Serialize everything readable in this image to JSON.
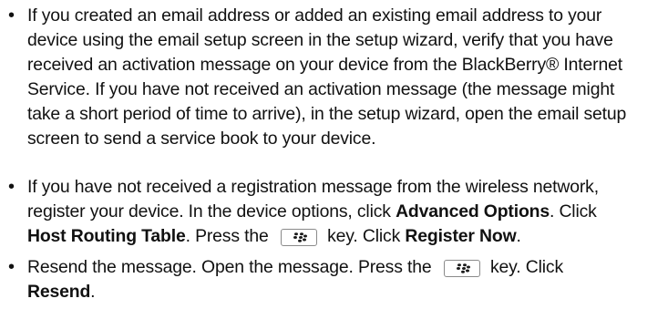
{
  "bullet_glyph": "•",
  "item1": {
    "l1": "If you created an email address or added an existing email address to your",
    "l2": "device using the email setup screen in the setup wizard, verify that you have",
    "l3": "received an activation message on your device from the BlackBerry® Internet",
    "l4": "Service. If you have not received an activation message (the message might",
    "l5": "take a short period of time to arrive), in the setup wizard, open the email setup",
    "l6": "screen to send a service book to your device."
  },
  "item2": {
    "l1": "If you have not received a registration message from the wireless network,",
    "l2a": "register your device. In the device options, click ",
    "l2b": "Advanced Options",
    "l2c": ". Click",
    "l3a": "Host Routing Table",
    "l3b": ". Press the ",
    "l3c": " key. Click ",
    "l3d": "Register Now",
    "l3e": "."
  },
  "item3": {
    "l1a": "Resend the message. Open the message. Press the ",
    "l1b": " key. Click",
    "l2a": "Resend",
    "l2b": "."
  },
  "key_icon": "blackberry-menu-key-icon"
}
